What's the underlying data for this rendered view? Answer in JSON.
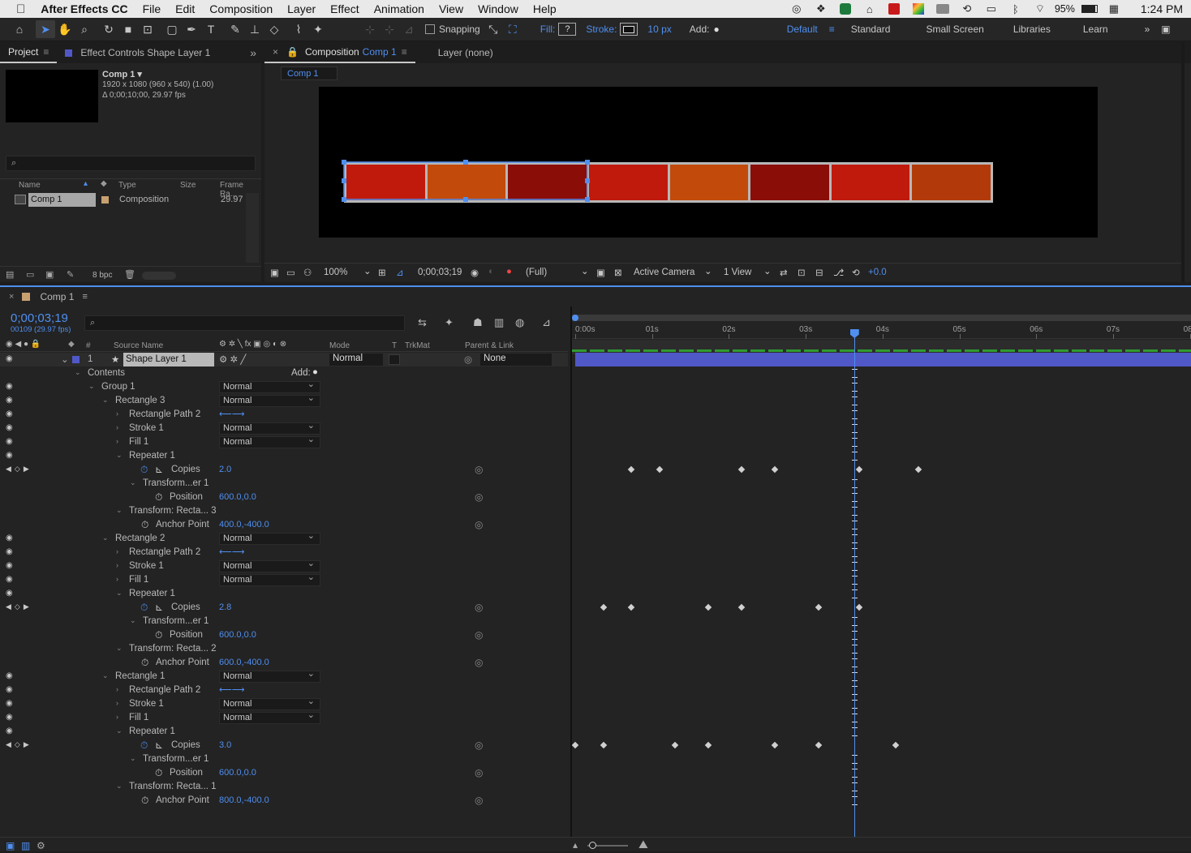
{
  "menubar": {
    "app": "After Effects CC",
    "items": [
      "File",
      "Edit",
      "Composition",
      "Layer",
      "Effect",
      "Animation",
      "View",
      "Window",
      "Help"
    ],
    "battery": "95%",
    "clock": "1:24 PM"
  },
  "toolbar": {
    "snapping_label": "Snapping",
    "fill_label": "Fill:",
    "fill_value": "?",
    "stroke_label": "Stroke:",
    "stroke_width": "10 px",
    "add_label": "Add:",
    "workspaces": [
      "Default",
      "Standard",
      "Small Screen",
      "Libraries",
      "Learn"
    ]
  },
  "project_panel": {
    "tab_project": "Project",
    "tab_effect_controls": "Effect Controls Shape Layer 1",
    "comp_name": "Comp 1 ▾",
    "comp_size": "1920 x 1080  (960 x 540) (1.00)",
    "comp_duration": "Δ 0;00;10;00, 29.97 fps",
    "columns": {
      "name": "Name",
      "type": "Type",
      "size": "Size",
      "frame_rate": "Frame Ra..."
    },
    "items": [
      {
        "name": "Comp 1",
        "type": "Composition",
        "size": "",
        "frame_rate": "29.97"
      }
    ],
    "bpc": "8 bpc"
  },
  "comp_panel": {
    "tab_composition": "Composition",
    "tab_comp_name": "Comp 1",
    "tab_layer": "Layer (none)",
    "breadcrumb": "Comp 1",
    "zoom": "100%",
    "timecode": "0;00;03;19",
    "resolution": "(Full)",
    "camera": "Active Camera",
    "view": "1 View",
    "exposure": "+0.0",
    "tile_colors": [
      "#c01a0c",
      "#c24a0a",
      "#8a0d08",
      "#c01a0c",
      "#c24a0a",
      "#8a0d08",
      "#c01a0c",
      "#b23a0a"
    ]
  },
  "timeline": {
    "tab": "Comp 1",
    "timecode": "0;00;03;19",
    "frames": "00109 (29.97 fps)",
    "col_source_name": "Source Name",
    "col_mode": "Mode",
    "col_t": "T",
    "col_trkmat": "TrkMat",
    "col_parent": "Parent & Link",
    "ruler": [
      "0:00s",
      "01s",
      "02s",
      "03s",
      "04s",
      "05s",
      "06s",
      "07s",
      "08"
    ],
    "layer": {
      "index": "1",
      "name": "Shape Layer 1",
      "mode": "Normal",
      "parent": "None"
    },
    "add_label": "Add:",
    "rows": [
      {
        "label": "Contents"
      },
      {
        "label": "Group 1",
        "value": "Normal"
      },
      {
        "label": "Rectangle 3",
        "value": "Normal"
      },
      {
        "label": "Rectangle Path 2"
      },
      {
        "label": "Stroke 1",
        "value": "Normal"
      },
      {
        "label": "Fill 1",
        "value": "Normal"
      },
      {
        "label": "Repeater 1"
      },
      {
        "label": "Copies",
        "value": "2.0"
      },
      {
        "label": "Transform...er 1"
      },
      {
        "label": "Position",
        "value": "600.0,0.0"
      },
      {
        "label": "Transform: Recta... 3"
      },
      {
        "label": "Anchor Point",
        "value": "400.0,-400.0"
      },
      {
        "label": "Rectangle 2",
        "value": "Normal"
      },
      {
        "label": "Rectangle Path 2"
      },
      {
        "label": "Stroke 1",
        "value": "Normal"
      },
      {
        "label": "Fill 1",
        "value": "Normal"
      },
      {
        "label": "Repeater 1"
      },
      {
        "label": "Copies",
        "value": "2.8"
      },
      {
        "label": "Transform...er 1"
      },
      {
        "label": "Position",
        "value": "600.0,0.0"
      },
      {
        "label": "Transform: Recta... 2"
      },
      {
        "label": "Anchor Point",
        "value": "600.0,-400.0"
      },
      {
        "label": "Rectangle 1",
        "value": "Normal"
      },
      {
        "label": "Rectangle Path 2"
      },
      {
        "label": "Stroke 1",
        "value": "Normal"
      },
      {
        "label": "Fill 1",
        "value": "Normal"
      },
      {
        "label": "Repeater 1"
      },
      {
        "label": "Copies",
        "value": "3.0"
      },
      {
        "label": "Transform...er 1"
      },
      {
        "label": "Position",
        "value": "600.0,0.0"
      },
      {
        "label": "Transform: Recta... 1"
      },
      {
        "label": "Anchor Point",
        "value": "800.0,-400.0"
      }
    ],
    "keyframes_seconds": {
      "copies_rect3": [
        0.73,
        1.1,
        2.17,
        2.6,
        3.7,
        4.47
      ],
      "copies_rect2": [
        0.37,
        0.73,
        1.73,
        2.17,
        3.17,
        3.7
      ],
      "copies_rect1": [
        0.0,
        0.37,
        1.3,
        1.73,
        2.6,
        3.17,
        4.17
      ]
    },
    "playhead_seconds": 3.63
  },
  "colors": {
    "accent": "#4f8ff0",
    "layer_bar": "#5058c8",
    "work_area": "#2f9a2f"
  }
}
